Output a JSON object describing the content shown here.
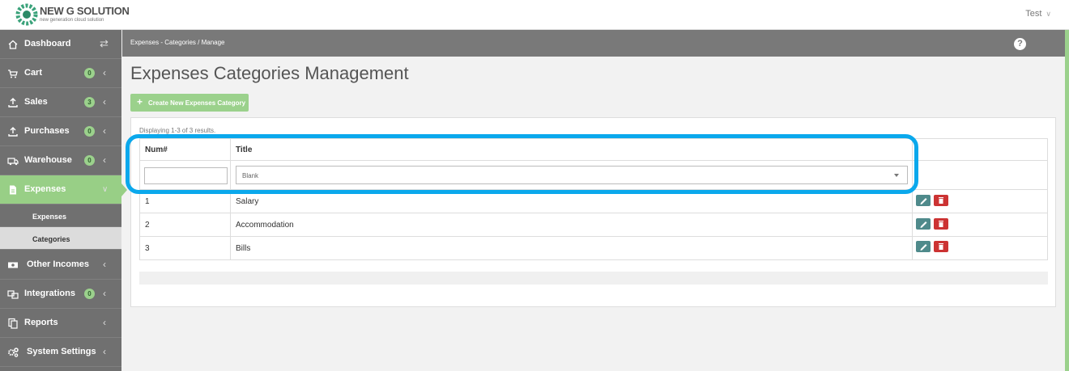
{
  "brand": {
    "name": "NEW G SOLUTION",
    "tagline": "new generation cloud solution",
    "accent": "#9bd18c"
  },
  "user": {
    "name": "Test"
  },
  "sidebar": {
    "items": [
      {
        "label": "Dashboard",
        "icon": "home-icon"
      },
      {
        "label": "Cart",
        "badge": "0",
        "icon": "cart-icon"
      },
      {
        "label": "Sales",
        "badge": "3",
        "icon": "upload-icon"
      },
      {
        "label": "Purchases",
        "badge": "0",
        "icon": "upload-icon"
      },
      {
        "label": "Warehouse",
        "badge": "0",
        "icon": "truck-icon"
      },
      {
        "label": "Expenses",
        "icon": "file-icon"
      },
      {
        "label": "Other Incomes",
        "icon": "money-icon"
      },
      {
        "label": "Integrations",
        "badge": "0",
        "icon": "link-icon"
      },
      {
        "label": "Reports",
        "icon": "copy-icon"
      },
      {
        "label": "System Settings",
        "icon": "gears-icon"
      }
    ],
    "submenu": [
      {
        "label": "Expenses"
      },
      {
        "label": "Categories"
      }
    ]
  },
  "breadcrumb": {
    "text": "Expenses - Categories  /  Manage"
  },
  "page": {
    "title": "Expenses Categories Management",
    "create_label": "Create New Expenses Category",
    "summary": "Displaying 1-3 of 3 results."
  },
  "table": {
    "columns": [
      "Num#",
      "Title"
    ],
    "filter": {
      "num_value": "",
      "title_selected": "Blank"
    },
    "rows": [
      {
        "num": "1",
        "title": "Salary"
      },
      {
        "num": "2",
        "title": "Accommodation"
      },
      {
        "num": "3",
        "title": "Bills"
      }
    ]
  },
  "colors": {
    "highlight": "#0aa8ec",
    "edit": "#4f8a8b",
    "delete": "#cc3333"
  }
}
